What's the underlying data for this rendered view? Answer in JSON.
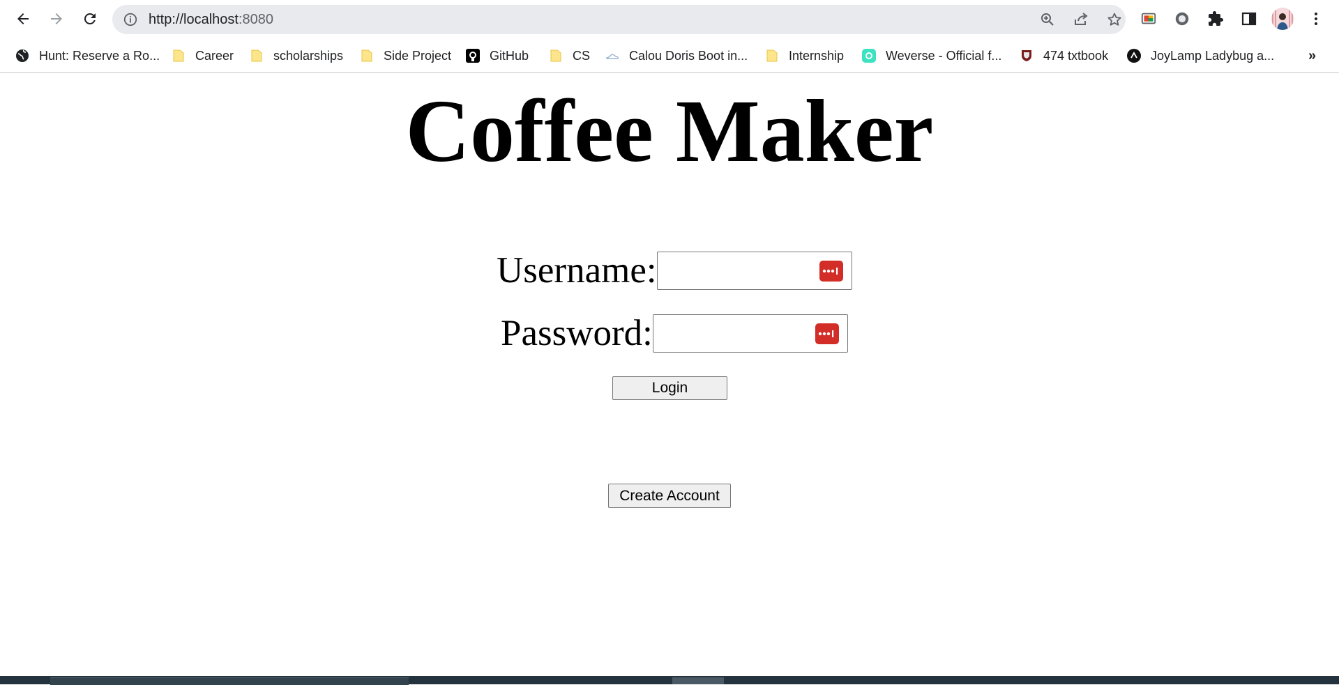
{
  "browser": {
    "url_host": "http://localhost",
    "url_port": ":8080",
    "colors": {
      "omnibox_bg": "#e8eaed",
      "lastpass_red": "#d32d27",
      "taskbar": "#23323c"
    }
  },
  "toolbar_icons": [
    "back-icon",
    "forward-icon",
    "reload-icon",
    "info-icon",
    "zoom-icon",
    "share-icon",
    "star-icon",
    "cast-icon",
    "extension-circle-icon",
    "puzzle-icon",
    "sidepanel-icon",
    "avatar",
    "kebab-menu-icon"
  ],
  "bookmarks": [
    {
      "label": "Hunt: Reserve a Ro...",
      "icon": "globe-icon"
    },
    {
      "label": "Career",
      "icon": "folder-icon"
    },
    {
      "label": "scholarships",
      "icon": "folder-icon"
    },
    {
      "label": "Side Project",
      "icon": "folder-icon"
    },
    {
      "label": "GitHub",
      "icon": "github-icon"
    },
    {
      "label": "CS",
      "icon": "folder-icon"
    },
    {
      "label": "Calou Doris Boot in...",
      "icon": "shoe-icon"
    },
    {
      "label": "Internship",
      "icon": "folder-icon"
    },
    {
      "label": "Weverse - Official f...",
      "icon": "weverse-icon"
    },
    {
      "label": "474 txtbook",
      "icon": "crest-icon"
    },
    {
      "label": "JoyLamp Ladybug a...",
      "icon": "joylamp-icon"
    }
  ],
  "bookmarks_overflow": "»",
  "page": {
    "title": "Coffee Maker",
    "username_label": "Username:",
    "username_value": "",
    "password_label": "Password:",
    "password_value": "",
    "login_label": "Login",
    "create_account_label": "Create Account"
  }
}
